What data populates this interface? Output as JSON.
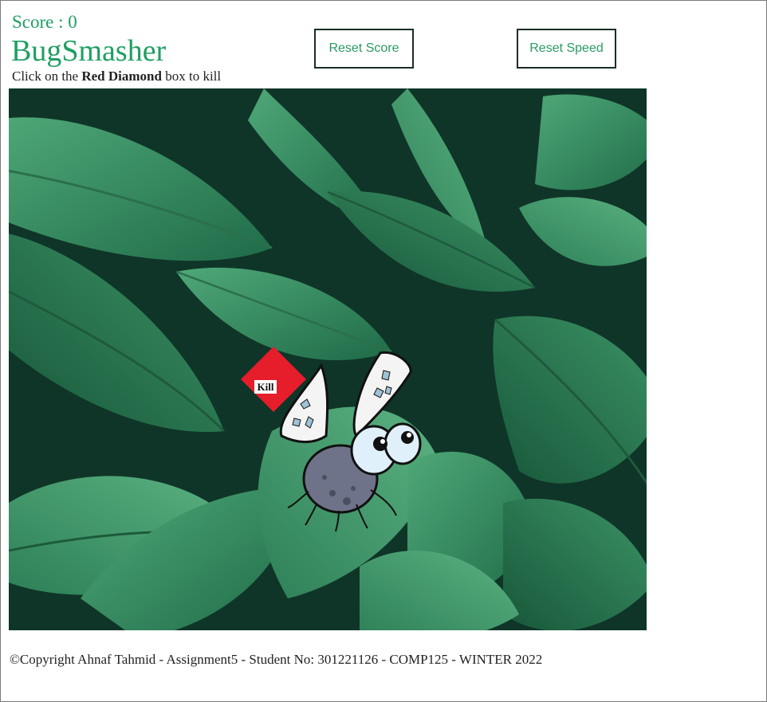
{
  "header": {
    "score_prefix": "Score : ",
    "score_value": "0",
    "title": "BugSmasher",
    "instructions": {
      "before": "Click on the ",
      "emphasis": "Red Diamond",
      "after": " box to kill"
    }
  },
  "buttons": {
    "reset_score": "Reset Score",
    "reset_speed": "Reset Speed"
  },
  "game": {
    "target_label": "Kill",
    "colors": {
      "accent_green": "#1f9f63",
      "target_red": "#e61d2b",
      "background_dark": "#0f3528"
    }
  },
  "footer": {
    "copyright": "©Copyright Ahnaf Tahmid - Assignment5 - Student No: 301221126 - COMP125 - WINTER 2022"
  }
}
